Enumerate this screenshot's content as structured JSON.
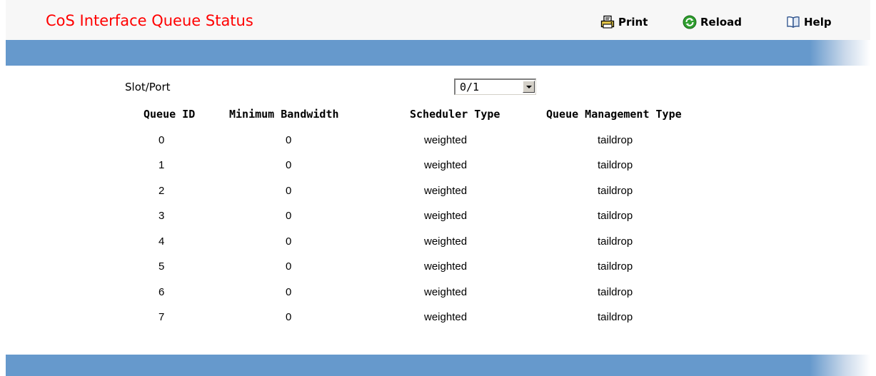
{
  "header": {
    "title": "CoS Interface Queue Status",
    "actions": {
      "print": "Print",
      "reload": "Reload",
      "help": "Help"
    }
  },
  "form": {
    "slot_port_label": "Slot/Port",
    "slot_port_value": "0/1"
  },
  "table": {
    "columns": [
      "Queue ID",
      "Minimum Bandwidth",
      "Scheduler Type",
      "Queue Management Type"
    ],
    "rows": [
      {
        "queue_id": "0",
        "min_bandwidth": "0",
        "scheduler": "weighted",
        "queue_mgmt": "taildrop"
      },
      {
        "queue_id": "1",
        "min_bandwidth": "0",
        "scheduler": "weighted",
        "queue_mgmt": "taildrop"
      },
      {
        "queue_id": "2",
        "min_bandwidth": "0",
        "scheduler": "weighted",
        "queue_mgmt": "taildrop"
      },
      {
        "queue_id": "3",
        "min_bandwidth": "0",
        "scheduler": "weighted",
        "queue_mgmt": "taildrop"
      },
      {
        "queue_id": "4",
        "min_bandwidth": "0",
        "scheduler": "weighted",
        "queue_mgmt": "taildrop"
      },
      {
        "queue_id": "5",
        "min_bandwidth": "0",
        "scheduler": "weighted",
        "queue_mgmt": "taildrop"
      },
      {
        "queue_id": "6",
        "min_bandwidth": "0",
        "scheduler": "weighted",
        "queue_mgmt": "taildrop"
      },
      {
        "queue_id": "7",
        "min_bandwidth": "0",
        "scheduler": "weighted",
        "queue_mgmt": "taildrop"
      }
    ]
  },
  "icons": {
    "print": "printer-icon",
    "reload": "reload-icon",
    "help": "book-icon"
  },
  "colors": {
    "title": "#ff0000",
    "bar": "#6699cc",
    "header_bg": "#f7f7f7",
    "reload_green": "#2e9e2e"
  }
}
